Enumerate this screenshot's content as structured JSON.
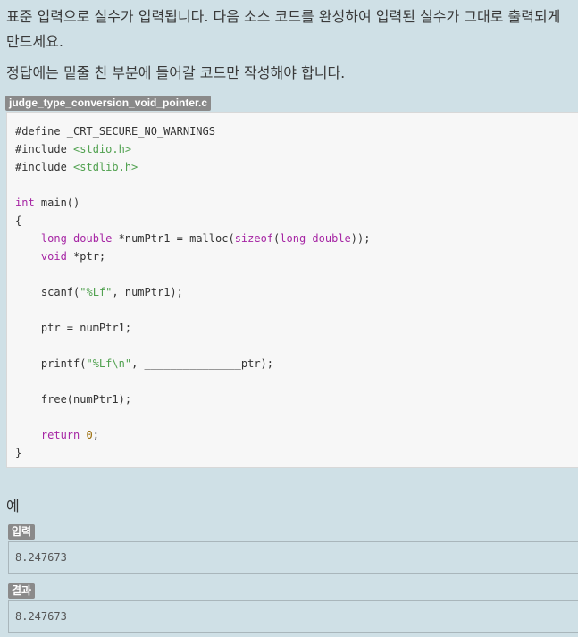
{
  "problem": {
    "description": "표준 입력으로 실수가 입력됩니다. 다음 소스 코드를 완성하여 입력된 실수가 그대로 출력되게 만드세요.",
    "instruction": "정답에는 밑줄 친 부분에 들어갈 코드만 작성해야 합니다."
  },
  "code_block": {
    "filename": "judge_type_conversion_void_pointer.c",
    "lines": {
      "l1": "#define _CRT_SECURE_NO_WARNINGS",
      "l2_kw": "#include",
      "l2_hdr": "<stdio.h>",
      "l3_kw": "#include",
      "l3_hdr": "<stdlib.h>",
      "l5_type": "int",
      "l5_rest": " main()",
      "l6": "{",
      "l7_long": "long",
      "l7_double": "double",
      "l7_mid": " *numPtr1 = malloc(",
      "l7_sizeof": "sizeof",
      "l7_long2": "long",
      "l7_double2": "double",
      "l7_end": "));",
      "l8_void": "void",
      "l8_rest": " *ptr;",
      "l10_a": "scanf(",
      "l10_str": "\"%Lf\"",
      "l10_b": ", numPtr1);",
      "l12": "ptr = numPtr1;",
      "l14_a": "printf(",
      "l14_str": "\"%Lf\\n\"",
      "l14_b": ", _______________ptr);",
      "l16": "free(numPtr1);",
      "l18_return": "return",
      "l18_zero": "0",
      "l18_semi": ";",
      "l19": "}"
    }
  },
  "example": {
    "heading": "예",
    "input_label": "입력",
    "input_value": "8.247673",
    "output_label": "결과",
    "output_value": "8.247673"
  }
}
